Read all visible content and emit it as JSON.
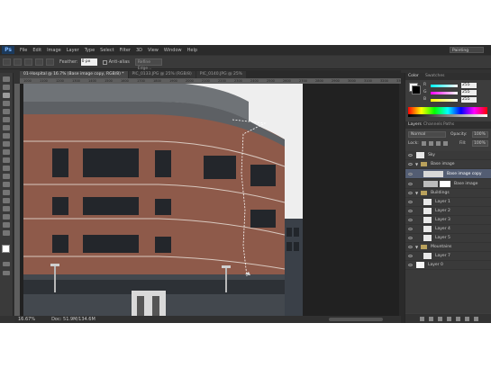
{
  "menubar": {
    "logo": "Ps",
    "items": [
      "File",
      "Edit",
      "Image",
      "Layer",
      "Type",
      "Select",
      "Filter",
      "3D",
      "View",
      "Window",
      "Help"
    ],
    "workspace": "Painting"
  },
  "options_bar": {
    "feather_label": "Feather:",
    "feather_value": "0 px",
    "antialias_label": "Anti-alias",
    "refine_label": "Refine Edge..."
  },
  "tabs": [
    {
      "label": "01-Hospital @ 16.7% (Base image copy, RGB/8) *",
      "active": true
    },
    {
      "label": "PIC_0133.JPG @ 25% (RGB/8)",
      "active": false
    },
    {
      "label": "PIC_0140.JPG @ 25%",
      "active": false
    }
  ],
  "ruler": {
    "marks": [
      "1000",
      "1100",
      "1200",
      "1300",
      "1400",
      "1500",
      "1600",
      "1700",
      "1800",
      "1900",
      "2000",
      "2100",
      "2200",
      "2300",
      "2400",
      "2500",
      "2600",
      "2700",
      "2800",
      "2900",
      "3000",
      "3100",
      "3200",
      "3300"
    ]
  },
  "statusbar": {
    "zoom": "16.67%",
    "doc": "Doc: 51.9M/134.6M"
  },
  "color_panel": {
    "tabs": [
      "Color",
      "Swatches"
    ],
    "r": "255",
    "g": "255",
    "b": "255",
    "fg_color": "#ffffff",
    "bg_color": "#000000"
  },
  "layers_panel": {
    "tabs": [
      "Layers",
      "Channels",
      "Paths"
    ],
    "blend_mode": "Normal",
    "opacity_label": "Opacity:",
    "opacity": "100%",
    "fill_label": "Fill:",
    "fill": "100%",
    "lock_label": "Lock:",
    "layers": [
      {
        "name": "Sky",
        "indent": 0,
        "kind": "layer",
        "selected": false
      },
      {
        "name": "Base image",
        "indent": 0,
        "kind": "group",
        "selected": false
      },
      {
        "name": "Base image copy",
        "indent": 1,
        "kind": "layer",
        "selected": true
      },
      {
        "name": "Base image",
        "indent": 1,
        "kind": "layer",
        "selected": false
      },
      {
        "name": "Buildings",
        "indent": 0,
        "kind": "group",
        "selected": false
      },
      {
        "name": "Layer 1",
        "indent": 1,
        "kind": "layer",
        "selected": false
      },
      {
        "name": "Layer 2",
        "indent": 1,
        "kind": "layer",
        "selected": false
      },
      {
        "name": "Layer 3",
        "indent": 1,
        "kind": "layer",
        "selected": false
      },
      {
        "name": "Layer 4",
        "indent": 1,
        "kind": "layer",
        "selected": false
      },
      {
        "name": "Layer 5",
        "indent": 1,
        "kind": "layer",
        "selected": false
      },
      {
        "name": "Mountains",
        "indent": 0,
        "kind": "group",
        "selected": false
      },
      {
        "name": "Layer 7",
        "indent": 1,
        "kind": "layer",
        "selected": false
      },
      {
        "name": "Layer 0",
        "indent": 0,
        "kind": "layer",
        "selected": false
      }
    ]
  },
  "colors": {
    "accent_selected": "#535d73",
    "app_bg": "#323232"
  }
}
